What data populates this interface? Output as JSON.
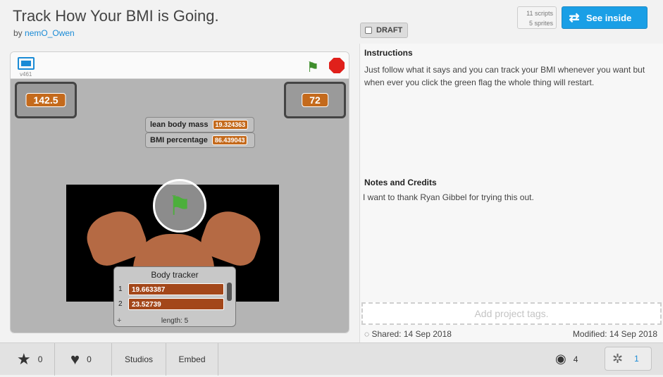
{
  "header": {
    "title": "Track How Your BMI is Going.",
    "by_prefix": "by",
    "author": "nemO_Owen",
    "draft_label": "DRAFT",
    "scripts": "11 scripts",
    "sprites": "5 sprites",
    "see_inside_label": "See inside"
  },
  "player": {
    "version": "v461",
    "monitor_left": "142.5",
    "monitor_right": "72",
    "lean_body_mass_label": "lean body mass",
    "lean_body_mass_value": "19.324363",
    "bmi_percentage_label": "BMI percentage",
    "bmi_percentage_value": "86.439043",
    "list": {
      "title": "Body tracker",
      "items": [
        {
          "index": "1",
          "value": "19.663387"
        },
        {
          "index": "2",
          "value": "23.52739"
        }
      ],
      "length": "length: 5",
      "plus": "+"
    }
  },
  "side": {
    "instructions_title": "Instructions",
    "instructions_text": "Just follow what it says and you can track your BMI whenever you want but when ever you click the green flag the whole thing will restart.",
    "notes_title": "Notes and Credits",
    "notes_text": "I want to thank Ryan Gibbel for trying this out.",
    "tags_placeholder": "Add project tags.",
    "shared": "Shared: 14 Sep 2018",
    "modified": "Modified: 14 Sep 2018"
  },
  "footer": {
    "favorites": "0",
    "loves": "0",
    "studios": "Studios",
    "embed": "Embed",
    "views": "4",
    "remixes": "1"
  },
  "colors": {
    "accent": "#1a9fe6",
    "monitor_value": "#c46a1c",
    "list_value": "#a3471a"
  }
}
